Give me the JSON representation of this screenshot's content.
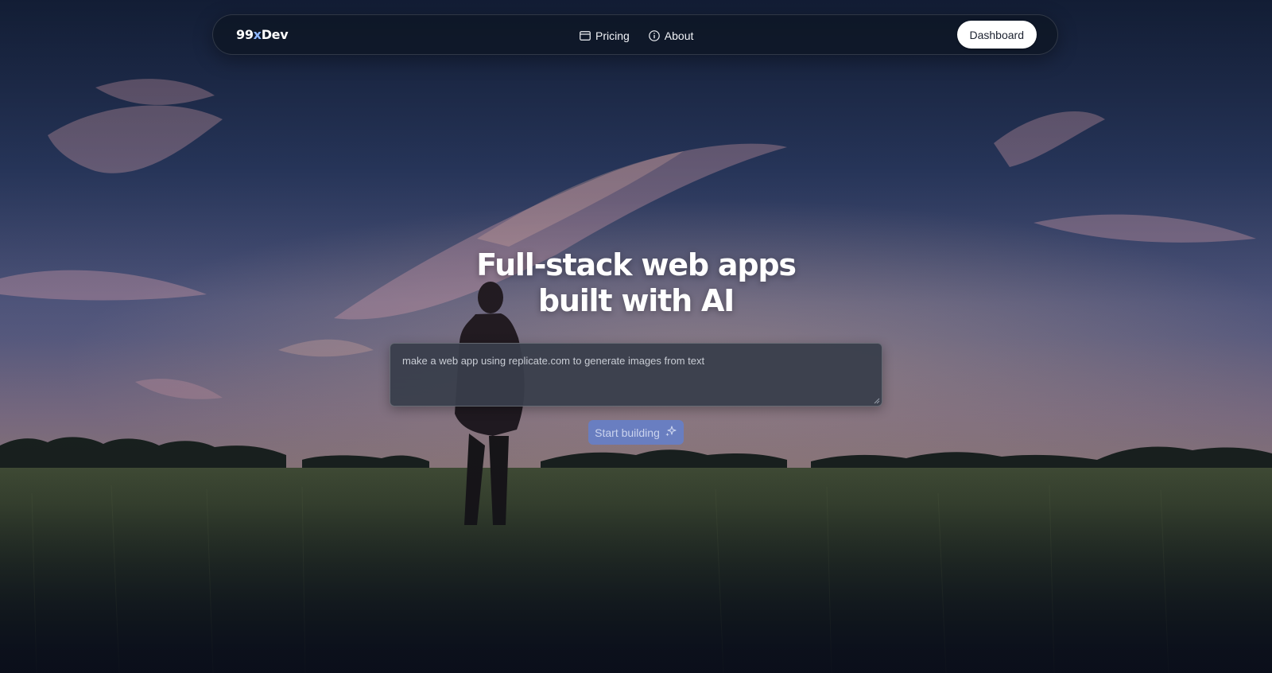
{
  "brand": {
    "prefix": "99",
    "accent": "x",
    "suffix": "Dev"
  },
  "nav": {
    "links": [
      {
        "label": "Pricing",
        "icon": "credit-card-icon"
      },
      {
        "label": "About",
        "icon": "info-circle-icon"
      }
    ],
    "dashboard_label": "Dashboard"
  },
  "hero": {
    "title_line1": "Full-stack web apps",
    "title_line2": "built with AI"
  },
  "prompt": {
    "placeholder": "make a web app using replicate.com to generate images from text",
    "value": ""
  },
  "cta": {
    "label": "Start building",
    "icon": "sparkles-icon"
  },
  "colors": {
    "accent": "#8fb8ff",
    "button_bg": "#6080d4",
    "nav_bg": "#0e1624"
  }
}
